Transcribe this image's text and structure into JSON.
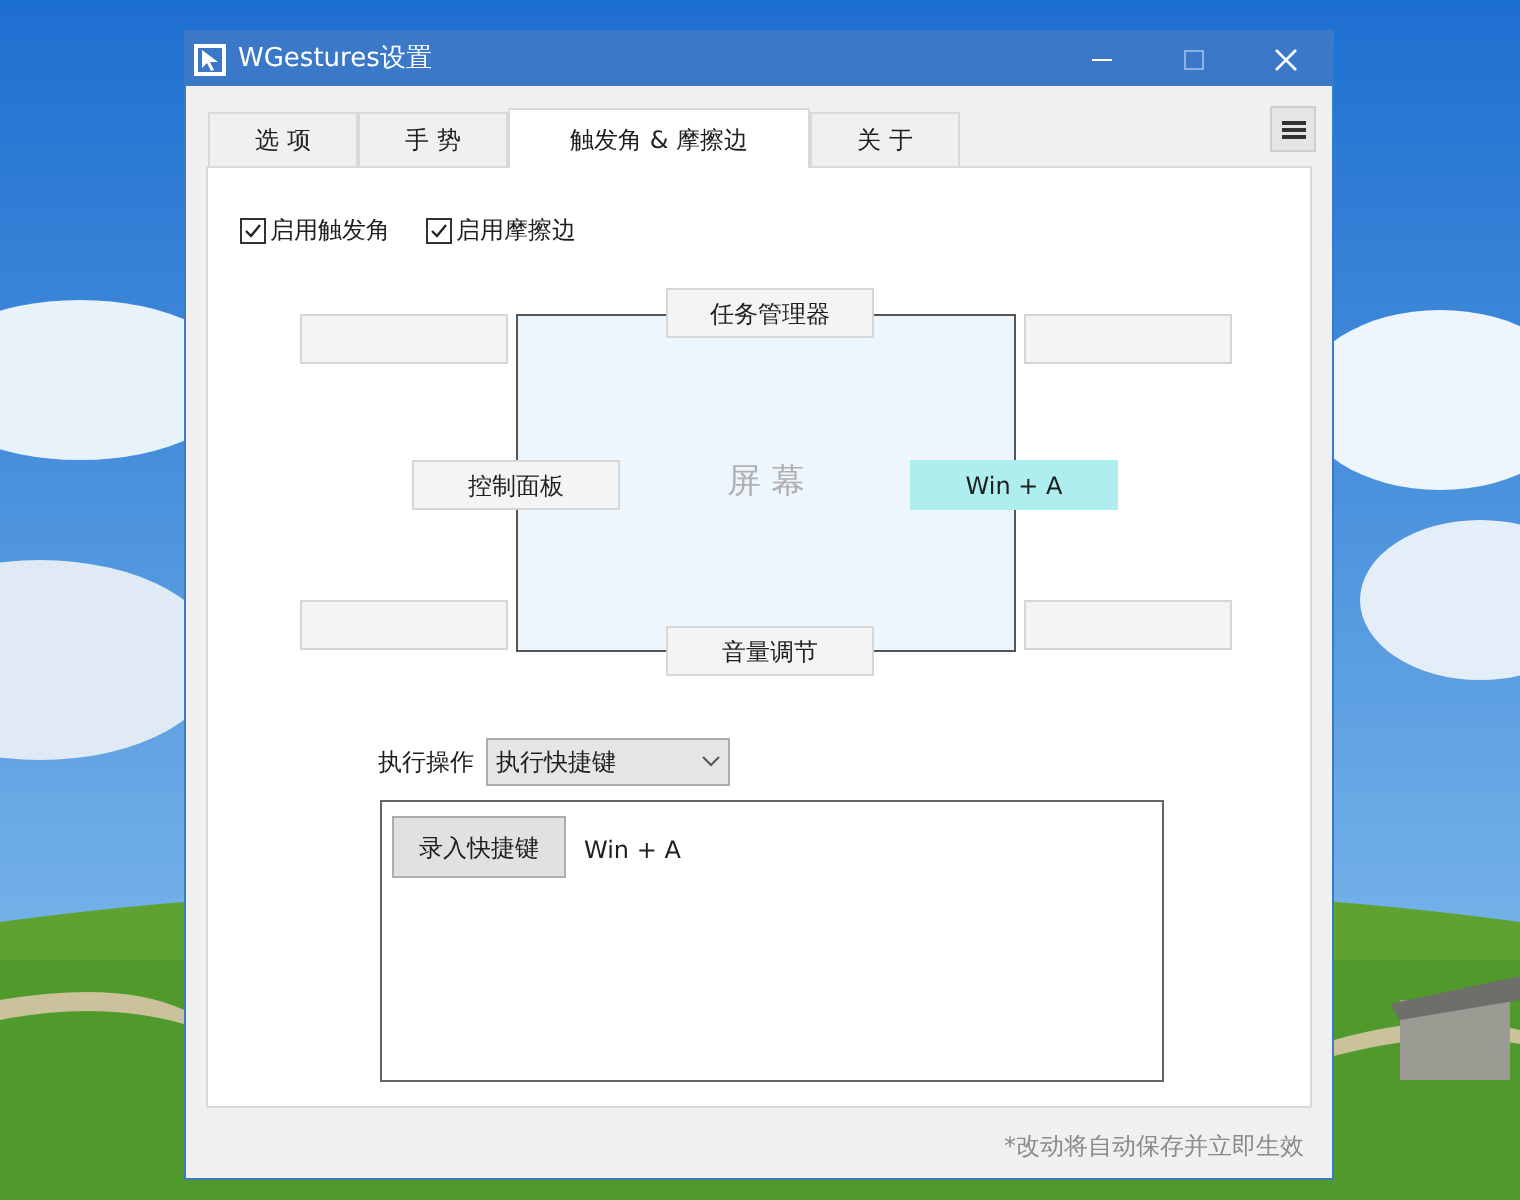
{
  "window": {
    "title": "WGestures设置"
  },
  "tabs": [
    {
      "label": "选 项",
      "selected": false
    },
    {
      "label": "手 势",
      "selected": false
    },
    {
      "label": "触发角 & 摩擦边",
      "selected": true
    },
    {
      "label": "关 于",
      "selected": false
    }
  ],
  "options": [
    {
      "label": "启用触发角",
      "checked": true
    },
    {
      "label": "启用摩擦边",
      "checked": true
    }
  ],
  "screen_label": "屏 幕",
  "corners": [
    {
      "selected": false
    },
    {
      "selected": false
    },
    {
      "selected": false
    },
    {
      "selected": false
    }
  ],
  "edges": [
    {
      "label": "任务管理器",
      "selected": false
    },
    {
      "label": "控制面板",
      "selected": false
    },
    {
      "label": "Win + A",
      "selected": true
    },
    {
      "label": "音量调节",
      "selected": false
    }
  ],
  "action": {
    "label": "执行操作",
    "value": "执行快捷键"
  },
  "record_button": "录入快捷键",
  "shortcut": "Win + A",
  "footer_note": "*改动将自动保存并立即生效"
}
